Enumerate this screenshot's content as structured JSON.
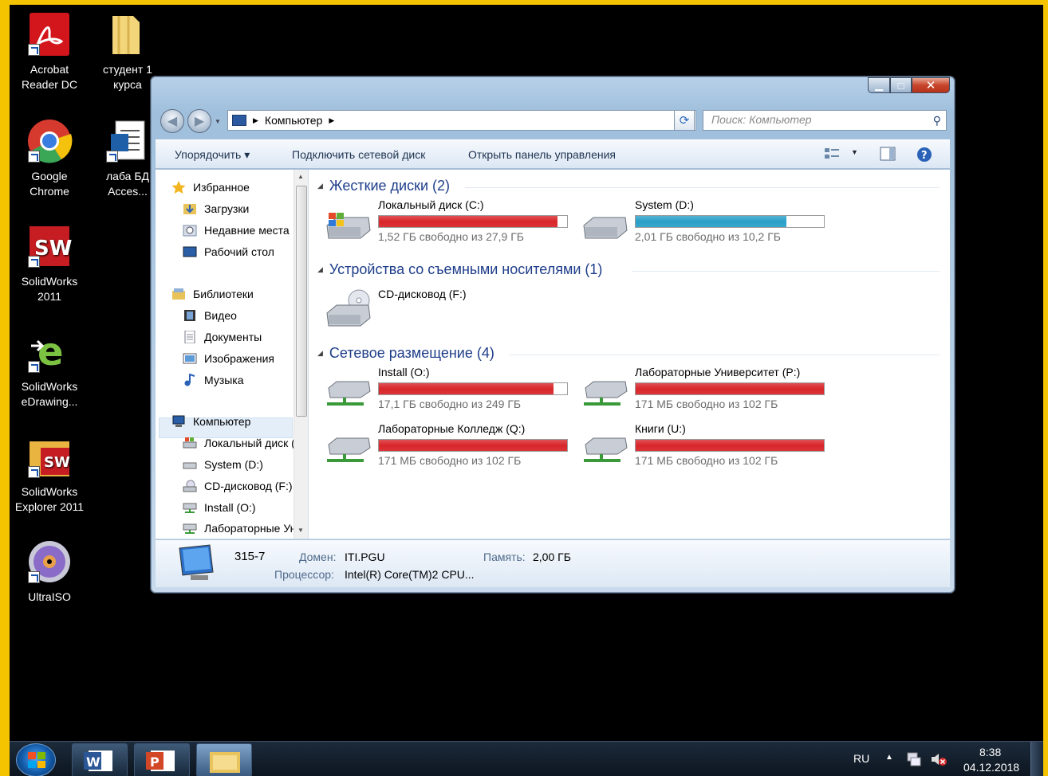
{
  "desktop": {
    "icons": [
      {
        "label": "Acrobat Reader DC"
      },
      {
        "label": "студент 1 курса"
      },
      {
        "label": "Google Chrome"
      },
      {
        "label": "лаба БД Acces..."
      },
      {
        "label": "SolidWorks 2011"
      },
      {
        "label": "SolidWorks eDrawing..."
      },
      {
        "label": "SolidWorks Explorer 2011"
      },
      {
        "label": "UltraISO"
      }
    ]
  },
  "window": {
    "address": {
      "crumb": "Компьютер"
    },
    "search": {
      "placeholder": "Поиск: Компьютер"
    },
    "toolbar": {
      "organize": "Упорядочить",
      "map_drive": "Подключить сетевой диск",
      "control_panel": "Открыть панель управления"
    },
    "nav": {
      "favorites": "Избранное",
      "downloads": "Загрузки",
      "recent": "Недавние места",
      "desktop": "Рабочий стол",
      "libraries": "Библиотеки",
      "video": "Видео",
      "documents": "Документы",
      "images": "Изображения",
      "music": "Музыка",
      "computer": "Компьютер",
      "local": "Локальный диск (C:)",
      "system": "System (D:)",
      "cd": "CD-дисковод (F:)",
      "install": "Install (O:)",
      "lab": "Лабораторные Университет (P:)"
    },
    "groups": {
      "hdd": "Жесткие диски (2)",
      "removable": "Устройства со съемными носителями (1)",
      "network": "Сетевое размещение (4)"
    },
    "drives": {
      "c": {
        "name": "Локальный диск (C:)",
        "free": "1,52 ГБ свободно из 27,9 ГБ",
        "used_fraction": 0.95,
        "color": "#d8262b"
      },
      "d": {
        "name": "System (D:)",
        "free": "2,01 ГБ свободно из 10,2 ГБ",
        "used_fraction": 0.8,
        "color": "#2aa0c8"
      },
      "f": {
        "name": "CD-дисковод (F:)"
      },
      "o": {
        "name": "Install (O:)",
        "free": "17,1 ГБ свободно из 249 ГБ",
        "used_fraction": 0.93,
        "color": "#d8262b"
      },
      "p": {
        "name": "Лабораторные Университет (P:)",
        "free": "171 МБ свободно из 102 ГБ",
        "used_fraction": 1.0,
        "color": "#d8262b"
      },
      "q": {
        "name": "Лабораторные Колледж (Q:)",
        "free": "171 МБ свободно из 102 ГБ",
        "used_fraction": 1.0,
        "color": "#d8262b"
      },
      "u": {
        "name": "Книги (U:)",
        "free": "171 МБ свободно из 102 ГБ",
        "used_fraction": 1.0,
        "color": "#d8262b"
      }
    },
    "details": {
      "computer_name": "315-7",
      "domain_key": "Домен:",
      "domain_val": "ITI.PGU",
      "memory_key": "Память:",
      "memory_val": "2,00 ГБ",
      "cpu_key": "Процессор:",
      "cpu_val": "Intel(R) Core(TM)2 CPU..."
    }
  },
  "taskbar": {
    "lang": "RU",
    "time": "8:38",
    "date": "04.12.2018"
  }
}
